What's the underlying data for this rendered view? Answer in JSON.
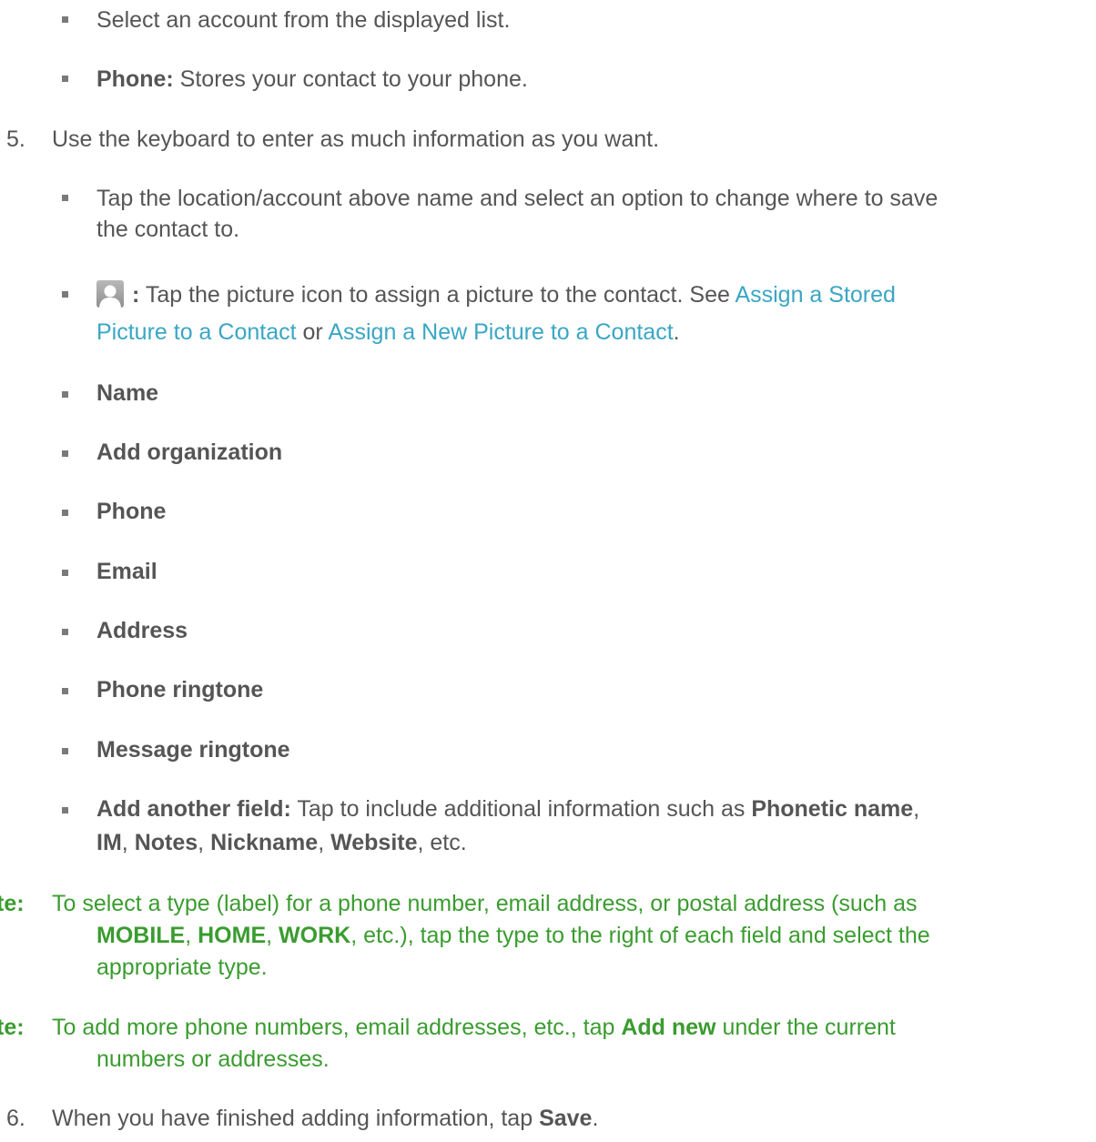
{
  "bullets_top": {
    "select_account": "Select an account from the displayed list.",
    "phone_label": "Phone:",
    "phone_text": " Stores your contact to your phone."
  },
  "step5": {
    "number": "5.",
    "text": "Use the keyboard to enter as much information as you want.",
    "location_line1": "Tap the location/account above name and select an option to change where to save",
    "location_line2": "the contact to.",
    "picture_colon": ":",
    "picture_text": " Tap the picture icon to assign a picture to the contact. See ",
    "link_stored_part1": "Assign a Stored",
    "link_stored_part2": "Picture to a Contact",
    "or_text": " or ",
    "link_new": "Assign a New Picture to a Contact",
    "period": ".",
    "fields": [
      "Name",
      "Add organization",
      "Phone",
      "Email",
      "Address",
      "Phone ringtone",
      "Message ringtone"
    ],
    "another_label": "Add another field:",
    "another_text": " Tap to include additional information such as ",
    "another_phonetic": "Phonetic name",
    "comma": ",",
    "another_im": "IM",
    "another_notes": "Notes",
    "another_nickname": "Nickname",
    "another_website": "Website",
    "another_etc": ", etc."
  },
  "note1": {
    "label": "te:",
    "line1": "To select a type (label) for a phone number, email address, or postal address (such as",
    "mobile": "MOBILE",
    "home": "HOME",
    "work": "WORK",
    "line2_rest": ", etc.), tap the type to the right of each field and select the",
    "line3": "appropriate type."
  },
  "note2": {
    "label": "te:",
    "line1_start": "To add more phone numbers, email addresses, etc., tap ",
    "add_new": "Add new",
    "line1_end": " under the current",
    "line2": "numbers or addresses."
  },
  "step6": {
    "number": "6.",
    "text_start": "When you have finished adding information, tap ",
    "save": "Save",
    "period": "."
  },
  "icons": {
    "bullet": "square-bullet-icon",
    "picture": "contact-picture-icon"
  },
  "colors": {
    "body_text": "#555555",
    "link": "#3aa6c4",
    "note": "#3a9c2f",
    "bullet": "#7a7a7a"
  }
}
